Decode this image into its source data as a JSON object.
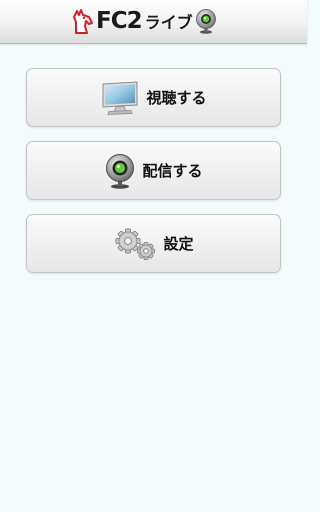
{
  "header": {
    "brand": "FC2",
    "product": "ライブ",
    "logo_icon": "fc2-horse-logo",
    "cam_icon": "webcam-icon"
  },
  "menu": [
    {
      "label": "視聴する",
      "icon": "monitor-icon"
    },
    {
      "label": "配信する",
      "icon": "webcam-icon"
    },
    {
      "label": "設定",
      "icon": "gears-icon"
    }
  ],
  "colors": {
    "background": "#f3fbfd",
    "logo_red": "#d0202a",
    "screen_blue": "#7fb6d6",
    "cam_green": "#5fcf3a"
  }
}
